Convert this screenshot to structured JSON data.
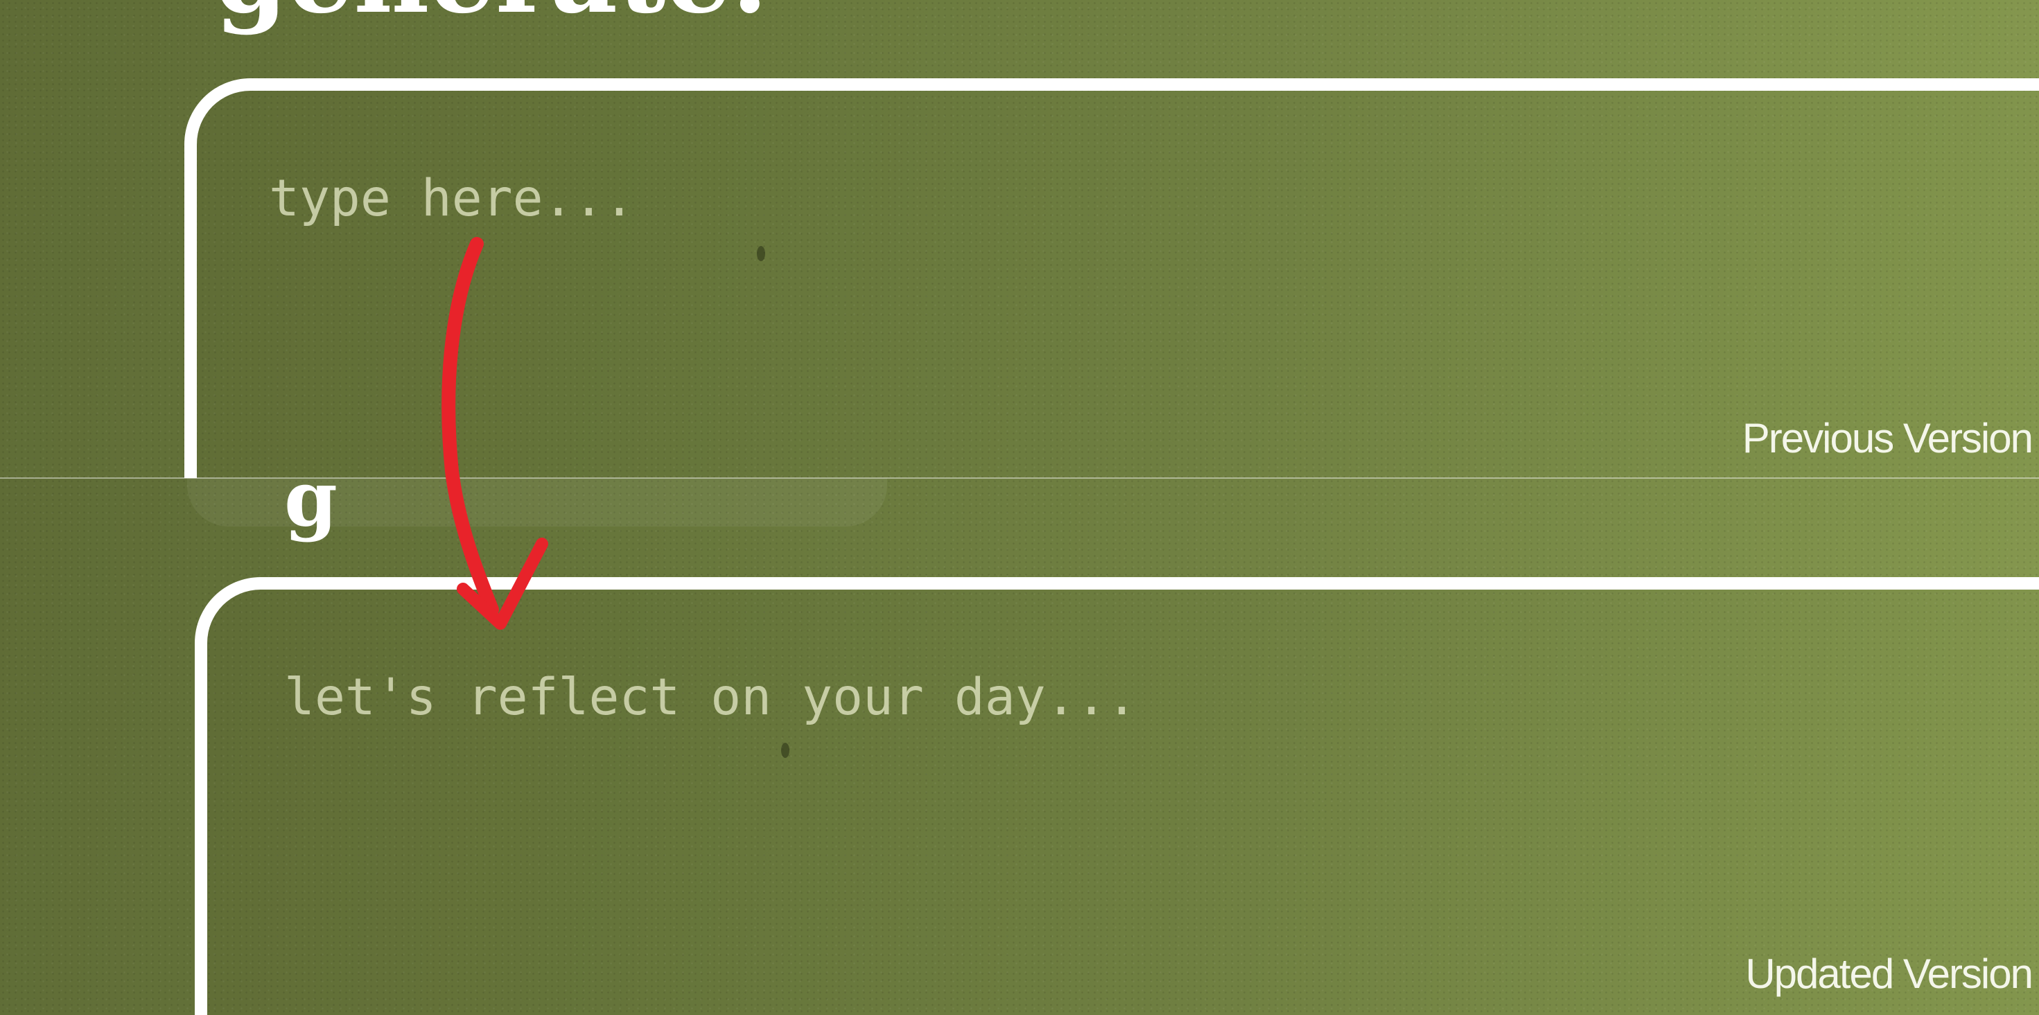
{
  "previous": {
    "heading_fragment": "generate.",
    "placeholder": "type here...",
    "label": "Previous Version"
  },
  "updated": {
    "placeholder": "let's reflect on your day...",
    "label": "Updated Version"
  },
  "colors": {
    "background_dark": "#5f6c36",
    "background_light": "#86994f",
    "frame": "#ffffff",
    "placeholder": "#e1e6c3",
    "arrow": "#e8232a"
  },
  "icons": {
    "annotation": "red-arrow-icon"
  }
}
